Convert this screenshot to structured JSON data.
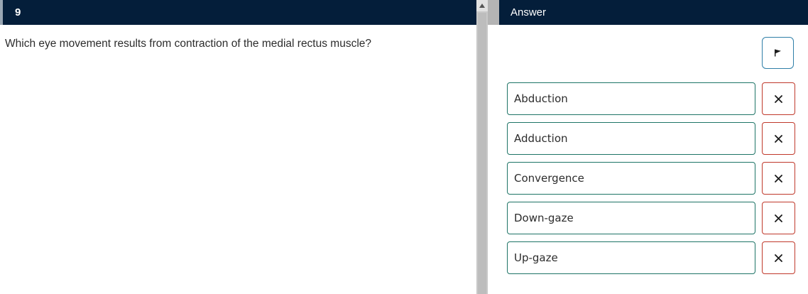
{
  "question": {
    "number": "9",
    "text": "Which eye movement results from contraction of the medial rectus muscle?"
  },
  "answer_panel": {
    "title": "Answer",
    "flag_icon": "flag-icon",
    "remove_icon": "close-icon",
    "options": [
      {
        "label": "Abduction"
      },
      {
        "label": "Adduction"
      },
      {
        "label": "Convergence"
      },
      {
        "label": "Down-gaze"
      },
      {
        "label": "Up-gaze"
      }
    ]
  },
  "colors": {
    "header": "#041e3a",
    "option_border": "#1e7466",
    "remove_border": "#c0392b",
    "flag_border": "#2f7fa8"
  }
}
